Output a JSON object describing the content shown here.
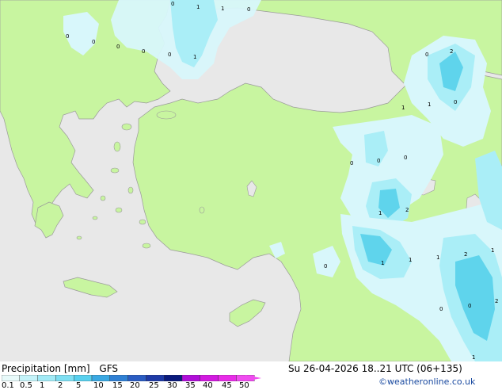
{
  "map": {
    "contour_labels": [
      {
        "text": "0"
      },
      {
        "text": "1"
      },
      {
        "text": "1"
      },
      {
        "text": "0"
      },
      {
        "text": "0"
      },
      {
        "text": "0"
      },
      {
        "text": "0"
      },
      {
        "text": "0"
      },
      {
        "text": "0"
      },
      {
        "text": "1"
      },
      {
        "text": "0"
      },
      {
        "text": "2"
      },
      {
        "text": "1"
      },
      {
        "text": "1"
      },
      {
        "text": "0"
      },
      {
        "text": "0"
      },
      {
        "text": "0"
      },
      {
        "text": "0"
      },
      {
        "text": "1"
      },
      {
        "text": "2"
      },
      {
        "text": "1"
      },
      {
        "text": "1"
      },
      {
        "text": "1"
      },
      {
        "text": "2"
      },
      {
        "text": "1"
      },
      {
        "text": "0"
      },
      {
        "text": "0"
      },
      {
        "text": "0"
      },
      {
        "text": "2"
      },
      {
        "text": "1"
      }
    ],
    "colors": {
      "sea": "#e8e8e8",
      "land": "#c8f5a0",
      "precip_light": "#d8f7fb",
      "precip_mid": "#aaeef7",
      "precip_strong": "#5fd4ec",
      "coast": "#9a9a9a"
    }
  },
  "legend": {
    "title": "Precipitation [mm]",
    "model": "GFS",
    "valid": "Su 26-04-2026 18..21 UTC (06+135)",
    "credit": "©weatheronline.co.uk",
    "ticks": [
      "0.1",
      "0.5",
      "1",
      "2",
      "5",
      "10",
      "15",
      "20",
      "25",
      "30",
      "35",
      "40",
      "45",
      "50"
    ],
    "colors": [
      "#e8fafa",
      "#c4f3f9",
      "#a2eaf6",
      "#7fdff2",
      "#58d0ee",
      "#3aa8e2",
      "#2f80d4",
      "#2a5cc2",
      "#1e3aa6",
      "#0a1a7c",
      "#b00ed8",
      "#d21ae0",
      "#e82ce8",
      "#f04cf0"
    ]
  }
}
